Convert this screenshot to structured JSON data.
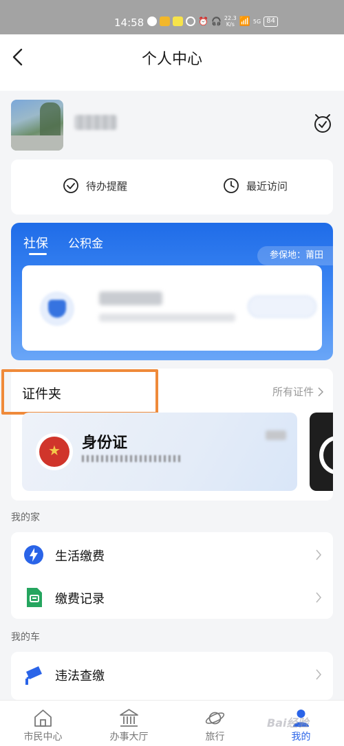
{
  "status_bar": {
    "time": "14:58",
    "net_speed_value": "22.3",
    "net_speed_unit": "K/s",
    "signal": "5G",
    "battery": "84"
  },
  "nav": {
    "title": "个人中心"
  },
  "quick_actions": [
    {
      "label": "待办提醒",
      "icon": "check-circle-icon"
    },
    {
      "label": "最近访问",
      "icon": "clock-icon"
    }
  ],
  "social_card": {
    "tabs": [
      {
        "label": "社保",
        "active": true
      },
      {
        "label": "公积金",
        "active": false
      }
    ],
    "region": "参保地：莆田"
  },
  "certificates": {
    "title": "证件夹",
    "all_link": "所有证件",
    "id_card_label": "身份证"
  },
  "home_section": {
    "label": "我的家",
    "items": [
      {
        "label": "生活缴费",
        "icon": "lightning-icon"
      },
      {
        "label": "缴费记录",
        "icon": "document-icon"
      }
    ]
  },
  "car_section": {
    "label": "我的车",
    "items": [
      {
        "label": "违法查缴",
        "icon": "camera-icon"
      }
    ]
  },
  "tab_bar": [
    {
      "label": "市民中心",
      "icon": "home-icon",
      "active": false
    },
    {
      "label": "办事大厅",
      "icon": "building-icon",
      "active": false
    },
    {
      "label": "旅行",
      "icon": "planet-icon",
      "active": false
    },
    {
      "label": "我的",
      "icon": "person-icon",
      "active": true
    }
  ],
  "colors": {
    "primary": "#2a64e8",
    "highlight_border": "#ef8a3a",
    "status_bar": "#a3a3a3"
  },
  "watermark": "Bai经验"
}
